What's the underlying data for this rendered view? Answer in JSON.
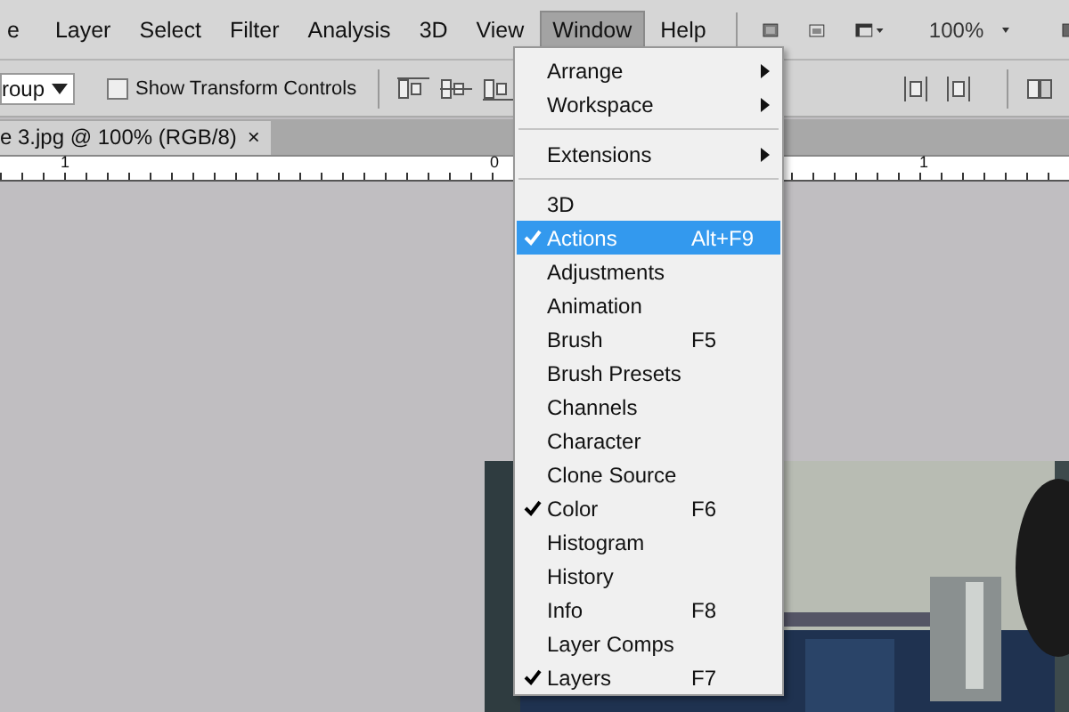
{
  "menubar": [
    {
      "label": "e",
      "selected": false
    },
    {
      "label": "Layer",
      "selected": false
    },
    {
      "label": "Select",
      "selected": false
    },
    {
      "label": "Filter",
      "selected": false
    },
    {
      "label": "Analysis",
      "selected": false
    },
    {
      "label": "3D",
      "selected": false
    },
    {
      "label": "View",
      "selected": false
    },
    {
      "label": "Window",
      "selected": true
    },
    {
      "label": "Help",
      "selected": false
    }
  ],
  "zoom": "100%",
  "options_bar": {
    "dropdown": "roup",
    "checkbox": {
      "label": "Show Transform Controls",
      "checked": false
    }
  },
  "document_tab": {
    "title": "e 3.jpg @ 100% (RGB/8)",
    "close": "×"
  },
  "ruler": [
    "1",
    "0",
    "1"
  ],
  "window_menu": [
    {
      "kind": "item",
      "label": "Arrange",
      "submenu": true,
      "checked": false,
      "selected": false
    },
    {
      "kind": "item",
      "label": "Workspace",
      "submenu": true,
      "checked": false,
      "selected": false
    },
    {
      "kind": "separator"
    },
    {
      "kind": "item",
      "label": "Extensions",
      "submenu": true,
      "checked": false,
      "selected": false
    },
    {
      "kind": "separator"
    },
    {
      "kind": "item",
      "label": "3D",
      "checked": false,
      "selected": false
    },
    {
      "kind": "item",
      "label": "Actions",
      "shortcut": "Alt+F9",
      "checked": true,
      "selected": true
    },
    {
      "kind": "item",
      "label": "Adjustments",
      "checked": false,
      "selected": false
    },
    {
      "kind": "item",
      "label": "Animation",
      "checked": false,
      "selected": false
    },
    {
      "kind": "item",
      "label": "Brush",
      "shortcut": "F5",
      "checked": false,
      "selected": false
    },
    {
      "kind": "item",
      "label": "Brush Presets",
      "checked": false,
      "selected": false
    },
    {
      "kind": "item",
      "label": "Channels",
      "checked": false,
      "selected": false
    },
    {
      "kind": "item",
      "label": "Character",
      "checked": false,
      "selected": false
    },
    {
      "kind": "item",
      "label": "Clone Source",
      "checked": false,
      "selected": false
    },
    {
      "kind": "item",
      "label": "Color",
      "shortcut": "F6",
      "checked": true,
      "selected": false
    },
    {
      "kind": "item",
      "label": "Histogram",
      "checked": false,
      "selected": false
    },
    {
      "kind": "item",
      "label": "History",
      "checked": false,
      "selected": false
    },
    {
      "kind": "item",
      "label": "Info",
      "shortcut": "F8",
      "checked": false,
      "selected": false
    },
    {
      "kind": "item",
      "label": "Layer Comps",
      "checked": false,
      "selected": false
    },
    {
      "kind": "item",
      "label": "Layers",
      "shortcut": "F7",
      "checked": true,
      "selected": false
    }
  ]
}
